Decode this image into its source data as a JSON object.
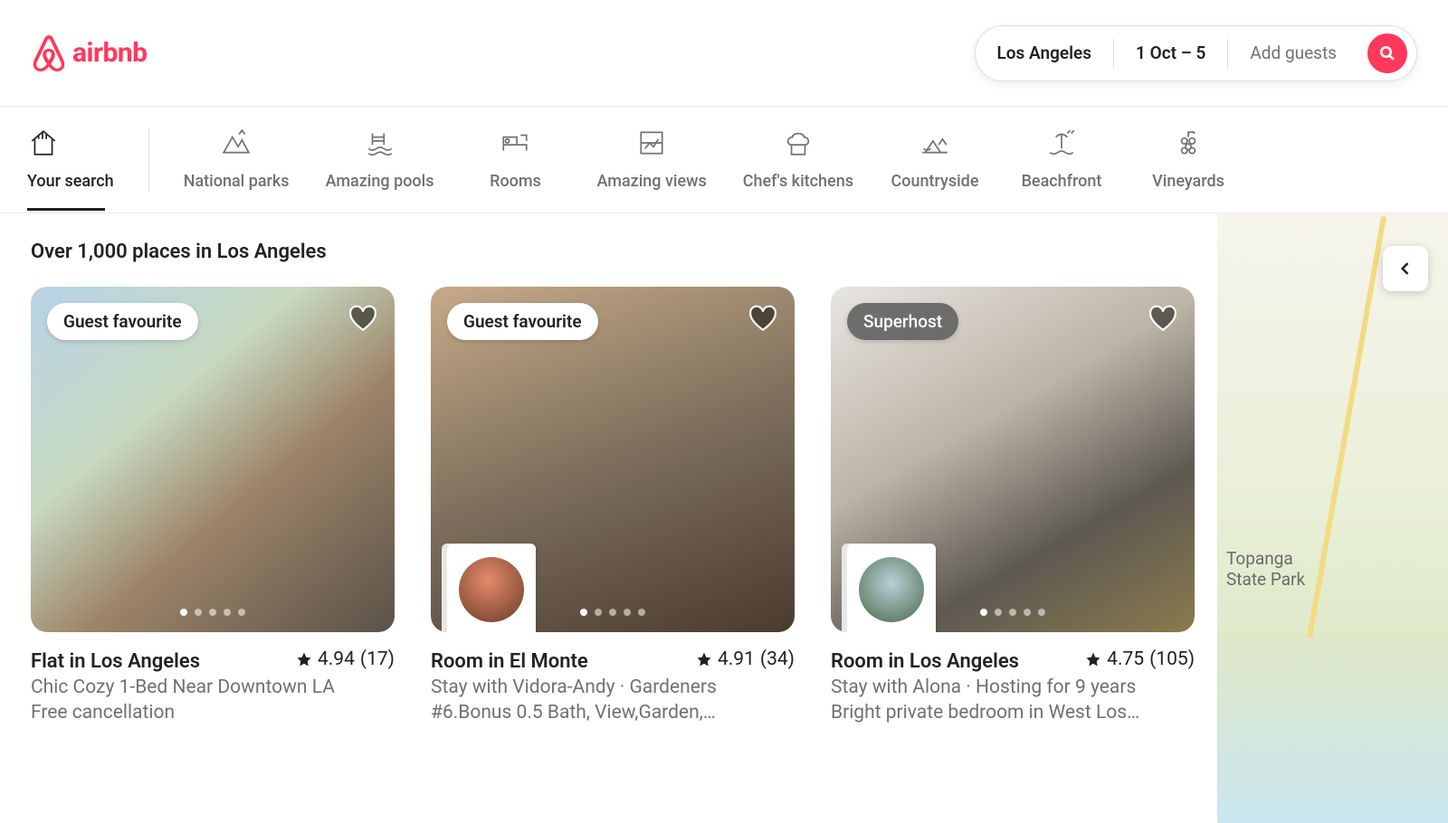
{
  "brand": {
    "name": "airbnb"
  },
  "search": {
    "location": "Los Angeles",
    "dates": "1 Oct – 5",
    "guests_placeholder": "Add guests"
  },
  "categories": [
    {
      "id": "your-search",
      "label": "Your search",
      "icon": "house-search",
      "active": true
    },
    {
      "id": "national-parks",
      "label": "National parks",
      "icon": "mountains",
      "active": false
    },
    {
      "id": "amazing-pools",
      "label": "Amazing pools",
      "icon": "pool",
      "active": false
    },
    {
      "id": "rooms",
      "label": "Rooms",
      "icon": "bed",
      "active": false
    },
    {
      "id": "amazing-views",
      "label": "Amazing views",
      "icon": "window-view",
      "active": false
    },
    {
      "id": "chefs-kitchens",
      "label": "Chef's kitchens",
      "icon": "chef-hat",
      "active": false
    },
    {
      "id": "countryside",
      "label": "Countryside",
      "icon": "countryside",
      "active": false
    },
    {
      "id": "beachfront",
      "label": "Beachfront",
      "icon": "beach",
      "active": false
    },
    {
      "id": "vineyards",
      "label": "Vineyards",
      "icon": "grapes",
      "active": false
    }
  ],
  "results": {
    "heading": "Over 1,000 places in Los Angeles",
    "listings": [
      {
        "badge": "Guest favourite",
        "badge_kind": "favourite",
        "has_host_avatar": false,
        "title": "Flat in Los Angeles",
        "rating": "4.94",
        "reviews": "(17)",
        "line1": "Chic Cozy 1-Bed Near Downtown LA",
        "line2": "Free cancellation",
        "active_dot": 0,
        "dot_count": 5
      },
      {
        "badge": "Guest favourite",
        "badge_kind": "favourite",
        "has_host_avatar": true,
        "title": "Room in El Monte",
        "rating": "4.91",
        "reviews": "(34)",
        "line1": "Stay with Vidora-Andy · Gardeners",
        "line2": "#6.Bonus 0.5 Bath, View,Garden,…",
        "active_dot": 0,
        "dot_count": 5
      },
      {
        "badge": "Superhost",
        "badge_kind": "superhost",
        "has_host_avatar": true,
        "title": "Room in Los Angeles",
        "rating": "4.75",
        "reviews": "(105)",
        "line1": "Stay with Alona · Hosting for 9 years",
        "line2": "Bright private bedroom in West Los…",
        "active_dot": 0,
        "dot_count": 5
      }
    ]
  },
  "map": {
    "visible_label_1": "Topanga",
    "visible_label_2": "State Park"
  }
}
